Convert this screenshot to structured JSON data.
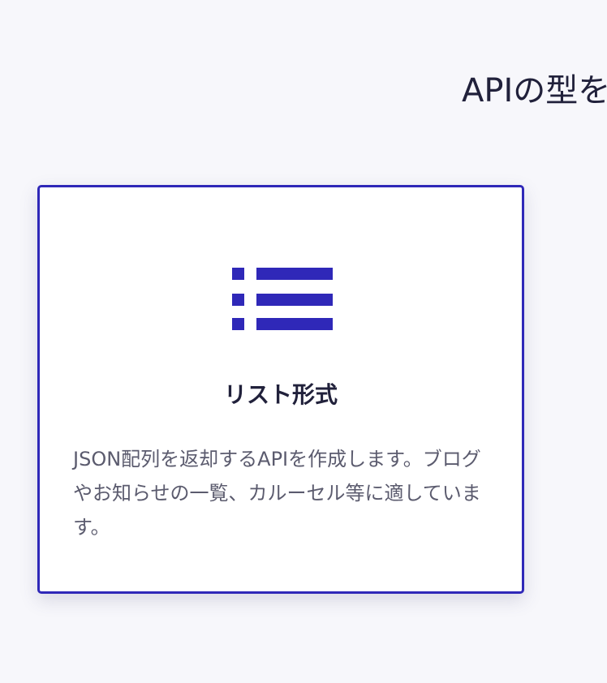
{
  "page": {
    "heading": "APIの型を"
  },
  "card": {
    "icon": "list-icon",
    "title": "リスト形式",
    "description": "JSON配列を返却するAPIを作成します。ブログやお知らせの一覧、カルーセル等に適しています。",
    "selected": true,
    "colors": {
      "accent": "#2f28b8",
      "background": "#ffffff",
      "page_background": "#f7f7fb",
      "title_text": "#21213b",
      "body_text": "#5b5b6e"
    }
  }
}
